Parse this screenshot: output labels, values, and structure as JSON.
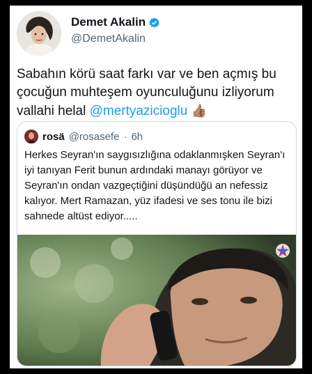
{
  "author": {
    "name": "Demet Akalin",
    "handle": "@DemetAkalin"
  },
  "tweet": {
    "text": "Sabahın körü saat farkı var ve ben açmış bu çocuğun muhteşem oyunculuğunu izliyorum vallahi helal ",
    "mention": "@mertyazicioglu",
    "emoji": "👍🏽"
  },
  "quote": {
    "name": "rosä",
    "handle": "@rosasefe",
    "separator": "·",
    "time": "6h",
    "text": "Herkes Seyran'ın saygısızlığına odaklanmışken Seyran'ı iyi tanıyan Ferit bunun ardındaki manayı görüyor ve Seyran'ın ondan vazgeçtiğini düşündüğü an nefessiz kalıyor. Mert Ramazan, yüz ifadesi ve ses tonu ile bizi sahnede altüst ediyor....."
  },
  "colors": {
    "accent": "#1d9bf0",
    "text": "#0f1419",
    "muted": "#536471"
  }
}
